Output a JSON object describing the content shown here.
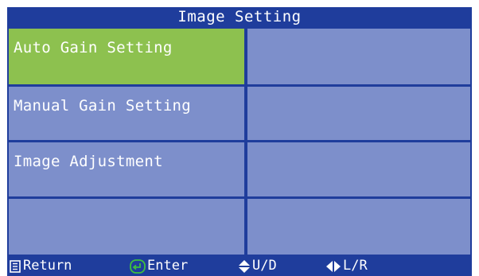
{
  "title": "Image Setting",
  "menu": {
    "items": [
      {
        "label": "Auto Gain Setting",
        "selected": true
      },
      {
        "label": "Manual Gain Setting",
        "selected": false
      },
      {
        "label": "Image Adjustment",
        "selected": false
      },
      {
        "label": "",
        "selected": false
      }
    ]
  },
  "footer": {
    "return_label": "Return",
    "enter_label": "Enter",
    "updown_label": "U/D",
    "leftright_label": "L/R",
    "return_icon": "return-icon",
    "enter_icon": "enter-icon",
    "updown_icon": "up-down-arrows-icon",
    "leftright_icon": "left-right-arrows-icon"
  },
  "colors": {
    "background": "#1f3d9c",
    "cell": "#7d8fcb",
    "selected": "#8dc14f",
    "text": "#ffffff",
    "enter_icon": "#3fbf3f"
  }
}
